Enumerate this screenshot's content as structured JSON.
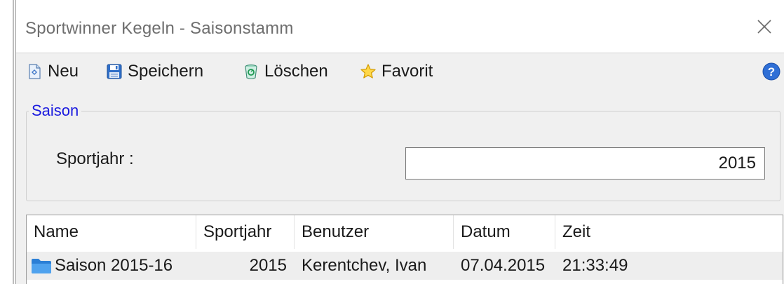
{
  "window": {
    "title": "Sportwinner Kegeln - Saisonstamm"
  },
  "toolbar": {
    "buttons": [
      {
        "label": "Neu",
        "icon": "new-document-icon"
      },
      {
        "label": "Speichern",
        "icon": "floppy-save-icon"
      },
      {
        "label": "Löschen",
        "icon": "recycle-bin-icon"
      },
      {
        "label": "Favorit",
        "icon": "star-icon"
      }
    ],
    "help_icon": "help-icon"
  },
  "season_group": {
    "legend": "Saison",
    "sportjahr_label": "Sportjahr :",
    "sportjahr_value": "2015"
  },
  "list": {
    "columns": [
      "Name",
      "Sportjahr",
      "Benutzer",
      "Datum",
      "Zeit"
    ],
    "rows": [
      {
        "icon": "folder-icon",
        "name": "Saison 2015-16",
        "sportjahr": "2015",
        "benutzer": "Kerentchev, Ivan",
        "datum": "07.04.2015",
        "zeit": "21:33:49"
      }
    ]
  },
  "colors": {
    "legend_text": "#1a1adf",
    "window_background": "#f0f0f0",
    "row_background": "#eeeeee",
    "folder_icon": "#3b8fe0"
  }
}
